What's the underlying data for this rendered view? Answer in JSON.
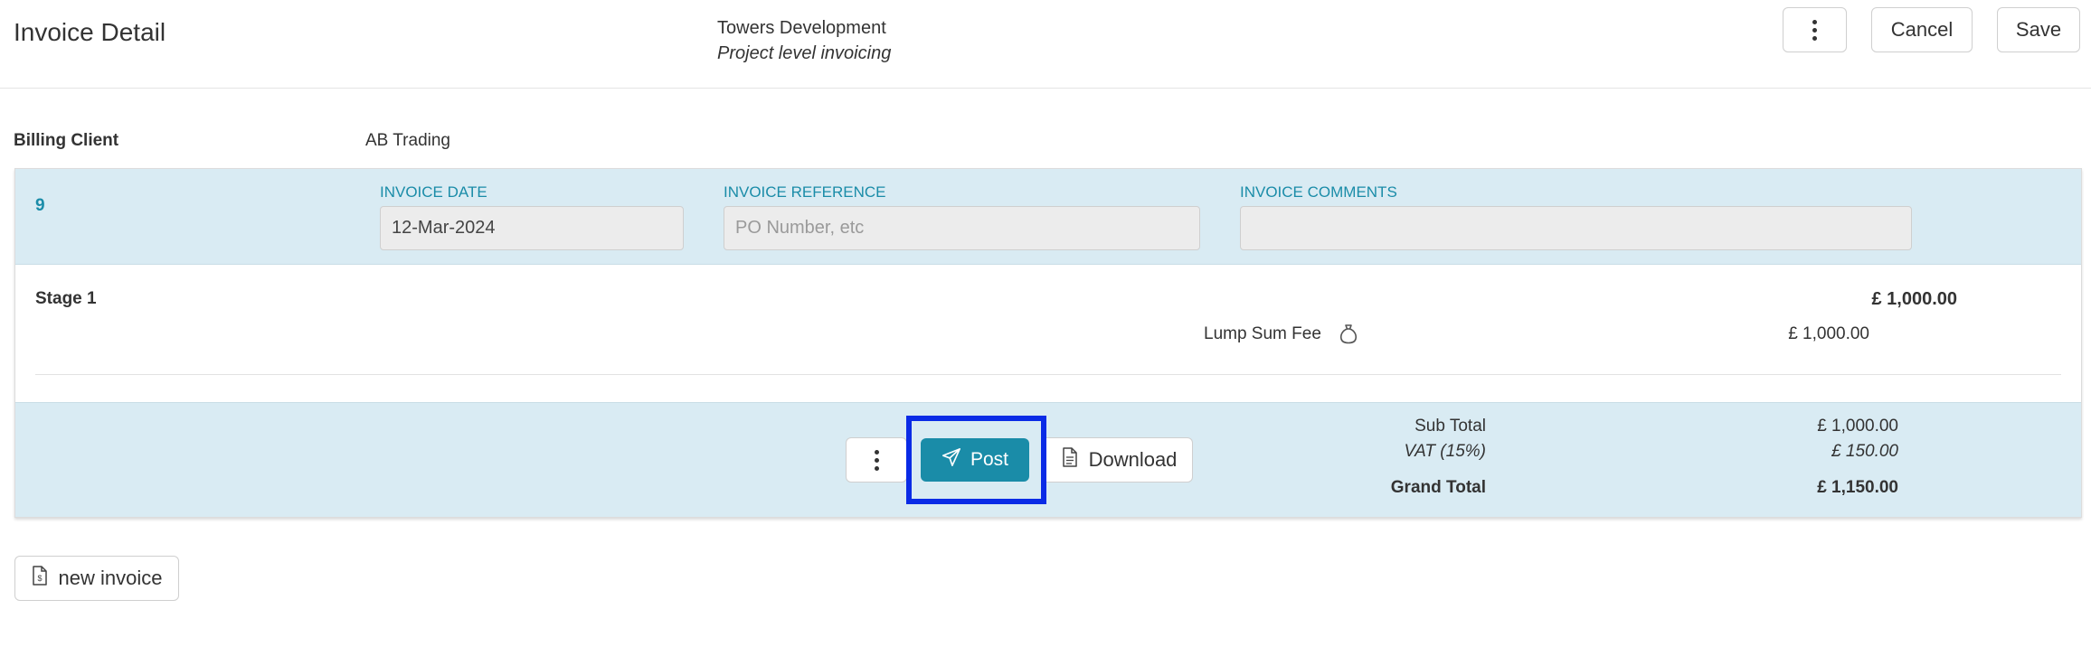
{
  "header": {
    "title": "Invoice Detail",
    "project_name": "Towers Development",
    "project_subtitle": "Project level invoicing",
    "cancel_label": "Cancel",
    "save_label": "Save"
  },
  "billing": {
    "label": "Billing Client",
    "value": "AB Trading"
  },
  "invoice": {
    "number": "9",
    "date_label": "INVOICE DATE",
    "date_value": "12-Mar-2024",
    "reference_label": "INVOICE REFERENCE",
    "reference_placeholder": "PO Number, etc",
    "comments_label": "INVOICE COMMENTS",
    "comments_value": ""
  },
  "stage": {
    "name": "Stage 1",
    "total": "£ 1,000.00",
    "items": [
      {
        "label": "Lump Sum Fee",
        "icon": "money-bag-icon",
        "value": "£ 1,000.00"
      }
    ]
  },
  "totals": {
    "subtotal_label": "Sub Total",
    "subtotal_value": "£ 1,000.00",
    "vat_label": "VAT (15%)",
    "vat_value": "£ 150.00",
    "grand_label": "Grand Total",
    "grand_value": "£ 1,150.00"
  },
  "actions": {
    "post_label": "Post",
    "download_label": "Download",
    "new_invoice_label": "new invoice"
  },
  "colors": {
    "accent": "#1a8ca8",
    "panel": "#d9ebf3",
    "focus": "#0a2be6"
  }
}
